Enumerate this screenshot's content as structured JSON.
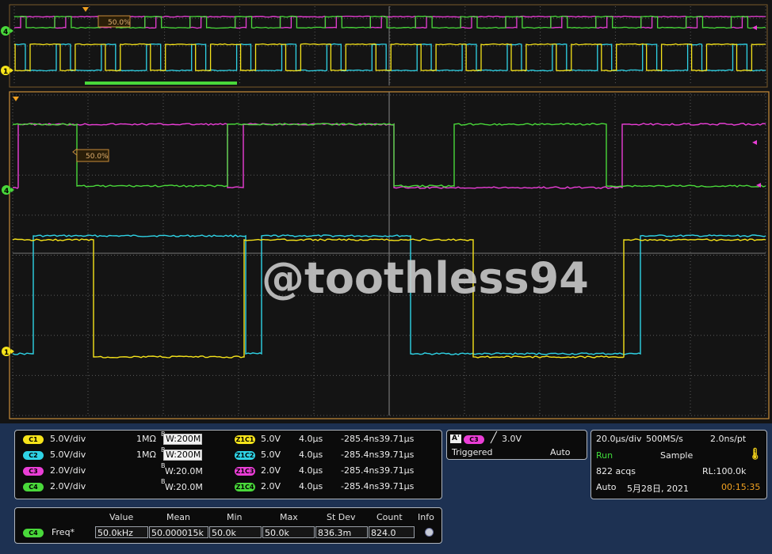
{
  "watermark": "@toothless94",
  "colors": {
    "c1": "#f6e31a",
    "c2": "#2fd3e6",
    "c3": "#ea3ed6",
    "c4": "#49d83a",
    "grid": "#5a5a5a",
    "frame": "#c88c3a"
  },
  "markers": {
    "zoom_label": "50.0%",
    "main_label": "50.0%",
    "ch4": "4",
    "ch1": "1"
  },
  "channels": [
    {
      "badge": "C1",
      "scale": "5.0V/div",
      "impedance": "1MΩ",
      "bw": "W:200M",
      "bw_mark": "B",
      "zoom": "Z1C1",
      "zoom_scale": "5.0V",
      "zoom_time": "4.0μs",
      "zoom_pos": "-285.4ns39.71μs",
      "color": "#f6e31a"
    },
    {
      "badge": "C2",
      "scale": "5.0V/div",
      "impedance": "1MΩ",
      "bw": "W:200M",
      "bw_mark": "B",
      "zoom": "Z1C2",
      "zoom_scale": "5.0V",
      "zoom_time": "4.0μs",
      "zoom_pos": "-285.4ns39.71μs",
      "color": "#2fd3e6"
    },
    {
      "badge": "C3",
      "scale": "2.0V/div",
      "impedance": "",
      "bw": "W:20.0M",
      "bw_mark": "B",
      "zoom": "Z1C3",
      "zoom_scale": "2.0V",
      "zoom_time": "4.0μs",
      "zoom_pos": "-285.4ns39.71μs",
      "color": "#ea3ed6"
    },
    {
      "badge": "C4",
      "scale": "2.0V/div",
      "impedance": "",
      "bw": "W:20.0M",
      "bw_mark": "B",
      "zoom": "Z1C4",
      "zoom_scale": "2.0V",
      "zoom_time": "4.0μs",
      "zoom_pos": "-285.4ns39.71μs",
      "color": "#49d83a"
    }
  ],
  "trigger": {
    "label_a": "A'",
    "source": "C3",
    "level": "3.0V",
    "status": "Triggered",
    "mode": "Auto"
  },
  "acquisition": {
    "timebase": "20.0μs/div",
    "rate": "500MS/s",
    "resolution": "2.0ns/pt",
    "state": "Run",
    "mode": "Sample",
    "acqs": "822 acqs",
    "record": "RL:100.0k",
    "auto": "Auto",
    "date": "5月28日, 2021",
    "time": "00:15:35"
  },
  "measurement": {
    "headers": [
      "Value",
      "Mean",
      "Min",
      "Max",
      "St Dev",
      "Count",
      "Info"
    ],
    "source": "C4",
    "name": "Freq*",
    "values": [
      "50.0kHz",
      "50.000015k",
      "50.0k",
      "50.0k",
      "836.3m",
      "824.0"
    ]
  }
}
